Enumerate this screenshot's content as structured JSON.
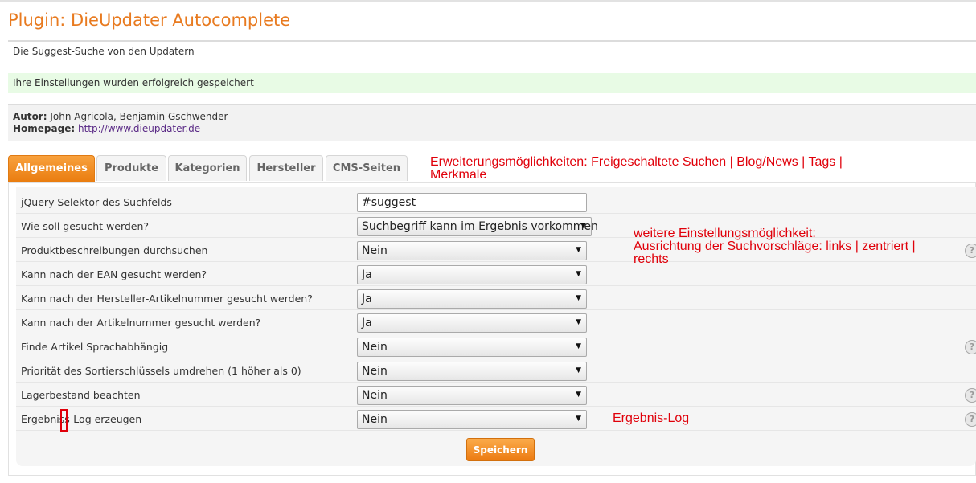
{
  "header": {
    "title": "Plugin: DieUpdater Autocomplete",
    "description": "Die Suggest-Suche von den Updatern"
  },
  "alert": {
    "success": "Ihre Einstellungen wurden erfolgreich gespeichert"
  },
  "info": {
    "author_label": "Autor:",
    "author": "John Agricola, Benjamin Gschwender",
    "homepage_label": "Homepage:",
    "homepage": "http://www.dieupdater.de"
  },
  "tabs": [
    {
      "label": "Allgemeines",
      "active": true
    },
    {
      "label": "Produkte"
    },
    {
      "label": "Kategorien"
    },
    {
      "label": "Hersteller"
    },
    {
      "label": "CMS-Seiten"
    }
  ],
  "annotations": {
    "extensions_line1": "Erweiterungsmöglichkeiten: Freigeschaltete Suchen | Blog/News | Tags |",
    "extensions_line2": "Merkmale",
    "settings_line1": "weitere Einstellungsmöglichkeit:",
    "settings_line2": "Ausrichtung der Suchvorschläge: links | zentriert |",
    "settings_line3": "rechts",
    "log": "Ergebnis-Log",
    "color": "#e0000a"
  },
  "settings": [
    {
      "label": "jQuery Selektor des Suchfelds",
      "type": "text",
      "value": "#suggest"
    },
    {
      "label": "Wie soll gesucht werden?",
      "type": "select",
      "value": "Suchbegriff kann im Ergebnis vorkommen"
    },
    {
      "label": "Produktbeschreibungen durchsuchen",
      "type": "select",
      "value": "Nein",
      "help": true
    },
    {
      "label": "Kann nach der EAN gesucht werden?",
      "type": "select",
      "value": "Ja"
    },
    {
      "label": "Kann nach der Hersteller-Artikelnummer gesucht werden?",
      "type": "select",
      "value": "Ja"
    },
    {
      "label": "Kann nach der Artikelnummer gesucht werden?",
      "type": "select",
      "value": "Ja"
    },
    {
      "label": "Finde Artikel Sprachabhängig",
      "type": "select",
      "value": "Nein",
      "help": true
    },
    {
      "label": "Priorität des Sortierschlüssels umdrehen (1 höher als 0)",
      "type": "select",
      "value": "Nein"
    },
    {
      "label": "Lagerbestand beachten",
      "type": "select",
      "value": "Nein",
      "help": true
    },
    {
      "label": "Ergebniss-Log erzeugen",
      "type": "select",
      "value": "Nein",
      "help": true
    }
  ],
  "help_icon": "question-mark-icon",
  "select_arrow": "▼",
  "help_glyph": "?",
  "buttons": {
    "save": "Speichern"
  },
  "colors": {
    "accent": "#e87a1f",
    "success_bg": "#e8fbe5",
    "button": "#ec7b12"
  }
}
